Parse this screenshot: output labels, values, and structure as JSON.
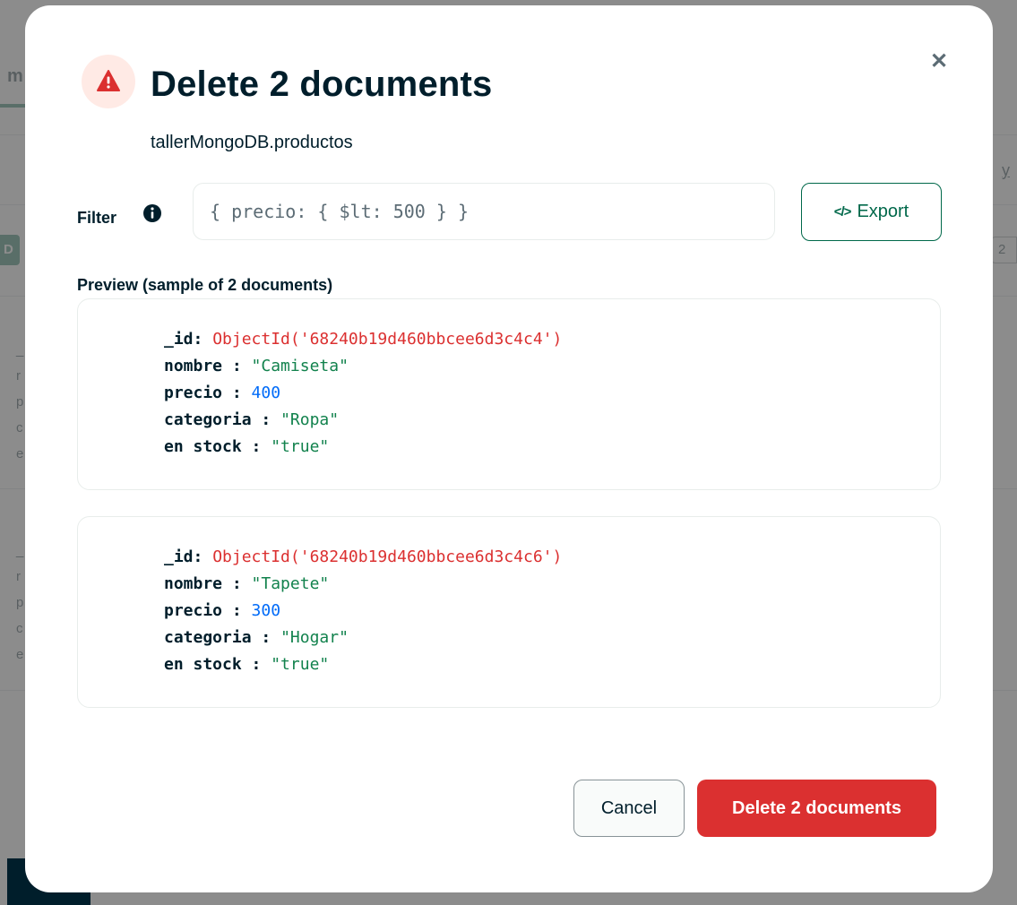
{
  "background": {
    "tab_fragment": "m",
    "button_fragment": "D",
    "right_fragment": "y",
    "right_box_fragment": "2",
    "doc_snippet_1": [
      "_",
      "r",
      "p",
      "c",
      "e"
    ],
    "doc_snippet_2": [
      "_",
      "r",
      "p",
      "c",
      "e"
    ]
  },
  "modal": {
    "title": "Delete 2 documents",
    "namespace": "tallerMongoDB.productos",
    "close_icon": "close-icon",
    "warning_icon": "warning-triangle-icon",
    "filter": {
      "label": "Filter",
      "info_icon": "info-icon",
      "value": "{ precio: { $lt: 500 } }"
    },
    "export_button": {
      "icon": "</>",
      "label": "Export"
    },
    "preview_heading": "Preview (sample of 2 documents)",
    "documents": [
      {
        "id_key": "_id",
        "id_value": "ObjectId('68240b19d460bbcee6d3c4c4')",
        "fields": [
          {
            "key": "nombre",
            "value": "\"Camiseta\"",
            "type": "string"
          },
          {
            "key": "precio",
            "value": "400",
            "type": "number"
          },
          {
            "key": "categoria",
            "value": "\"Ropa\"",
            "type": "string"
          },
          {
            "key": "en stock",
            "value": "\"true\"",
            "type": "string"
          }
        ]
      },
      {
        "id_key": "_id",
        "id_value": "ObjectId('68240b19d460bbcee6d3c4c6')",
        "fields": [
          {
            "key": "nombre",
            "value": "\"Tapete\"",
            "type": "string"
          },
          {
            "key": "precio",
            "value": "300",
            "type": "number"
          },
          {
            "key": "categoria",
            "value": "\"Hogar\"",
            "type": "string"
          },
          {
            "key": "en stock",
            "value": "\"true\"",
            "type": "string"
          }
        ]
      }
    ],
    "cancel_label": "Cancel",
    "delete_label": "Delete 2 documents"
  },
  "toast": {
    "close_icon": "close-icon"
  },
  "colors": {
    "danger": "#db3030",
    "danger_light": "#ffeae5",
    "brand_green": "#00684a",
    "string_green": "#12824d",
    "number_blue": "#016bf8",
    "overlay": "#6f6f6f"
  }
}
